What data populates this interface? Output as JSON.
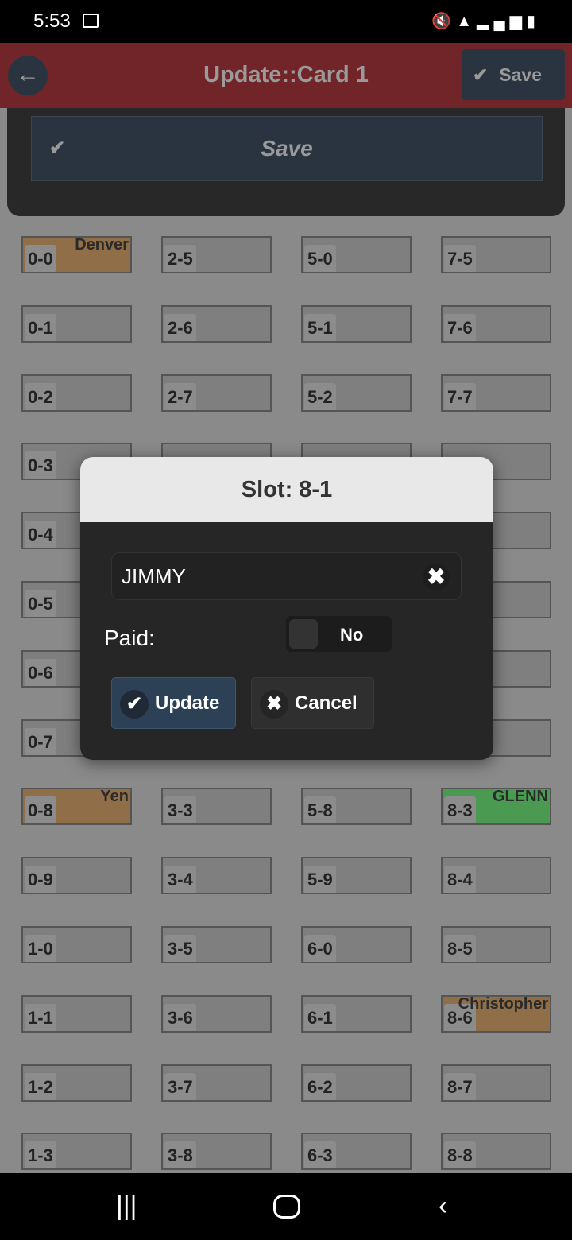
{
  "status": {
    "time": "5:53",
    "icons": [
      "image-icon",
      "mute-icon",
      "wifi-icon",
      "signal-icon",
      "signal-icon",
      "battery-charging-icon"
    ]
  },
  "header": {
    "title": "Update::Card 1",
    "save_label": "Save",
    "back_icon": "arrow-left-icon"
  },
  "panel": {
    "save_label": "Save"
  },
  "colors": {
    "header": "#722528",
    "paid_tan": "#8f6e48",
    "green": "#4a9a52",
    "button": "#2a3440"
  },
  "grid": {
    "columns": [
      [
        {
          "slot": "0-0",
          "name": "Denver",
          "color": "tan"
        },
        {
          "slot": "0-1"
        },
        {
          "slot": "0-2"
        },
        {
          "slot": "0-3"
        },
        {
          "slot": "0-4"
        },
        {
          "slot": "0-5"
        },
        {
          "slot": "0-6"
        },
        {
          "slot": "0-7"
        },
        {
          "slot": "0-8",
          "name": "Yen",
          "color": "tan"
        },
        {
          "slot": "0-9"
        },
        {
          "slot": "1-0"
        },
        {
          "slot": "1-1"
        },
        {
          "slot": "1-2"
        },
        {
          "slot": "1-3"
        }
      ],
      [
        {
          "slot": "2-5"
        },
        {
          "slot": "2-6"
        },
        {
          "slot": "2-7"
        },
        {},
        {},
        {},
        {},
        {},
        {
          "slot": "3-3"
        },
        {
          "slot": "3-4"
        },
        {
          "slot": "3-5"
        },
        {
          "slot": "3-6"
        },
        {
          "slot": "3-7"
        },
        {
          "slot": "3-8"
        }
      ],
      [
        {
          "slot": "5-0"
        },
        {
          "slot": "5-1"
        },
        {
          "slot": "5-2"
        },
        {},
        {},
        {},
        {},
        {},
        {
          "slot": "5-8"
        },
        {
          "slot": "5-9"
        },
        {
          "slot": "6-0"
        },
        {
          "slot": "6-1"
        },
        {
          "slot": "6-2"
        },
        {
          "slot": "6-3"
        }
      ],
      [
        {
          "slot": "7-5"
        },
        {
          "slot": "7-6"
        },
        {
          "slot": "7-7"
        },
        {},
        {},
        {},
        {},
        {},
        {
          "slot": "8-3",
          "name": "GLENN",
          "color": "green"
        },
        {
          "slot": "8-4"
        },
        {
          "slot": "8-5"
        },
        {
          "slot": "8-6",
          "name": "Christopher",
          "color": "tan"
        },
        {
          "slot": "8-7"
        },
        {
          "slot": "8-8"
        }
      ]
    ]
  },
  "modal": {
    "title": "Slot: 8-1",
    "name_value": "JIMMY",
    "paid_label": "Paid:",
    "paid_toggle": "No",
    "update_label": "Update",
    "cancel_label": "Cancel"
  }
}
